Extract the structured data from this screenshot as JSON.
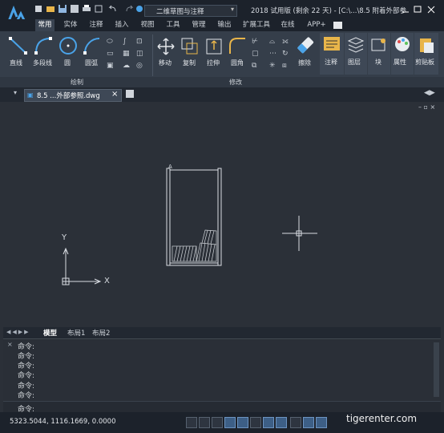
{
  "titlebar": {
    "workspace": "二维草图与注释",
    "title": "2018 试用版 (剩余 22 天) - [C:\\...\\8.5  附着外部参"
  },
  "menu": {
    "tabs": [
      "常用",
      "实体",
      "注释",
      "插入",
      "视图",
      "工具",
      "管理",
      "输出",
      "扩展工具",
      "在线",
      "APP+"
    ]
  },
  "ribbon": {
    "draw": {
      "group_label": "绘制",
      "line": "直线",
      "polyline": "多段线",
      "circle": "圆",
      "arc": "圆弧"
    },
    "modify": {
      "group_label": "修改",
      "move": "移动",
      "copy": "复制",
      "stretch": "拉伸",
      "fillet": "圆角",
      "erase": "擦除"
    },
    "right": {
      "annotate": "注释",
      "layers": "图层",
      "block": "块",
      "properties": "属性",
      "clipboard": "剪贴板"
    }
  },
  "document": {
    "tab_label": "8.5 ...外部参照.dwg"
  },
  "canvas": {
    "ucs_x": "X",
    "ucs_y": "Y",
    "drawing_mark": "A"
  },
  "layout_tabs": [
    "模型",
    "布局1",
    "布局2"
  ],
  "command": {
    "history": [
      "命令:",
      "命令:",
      "命令:",
      "命令:",
      "命令:",
      "命令:"
    ],
    "prompt": "命令:"
  },
  "status": {
    "coords": "5323.5044, 1116.1669, 0.0000"
  },
  "watermark": "tigerenter.com",
  "colors": {
    "accent": "#3d5f86",
    "background": "#2b3038"
  }
}
